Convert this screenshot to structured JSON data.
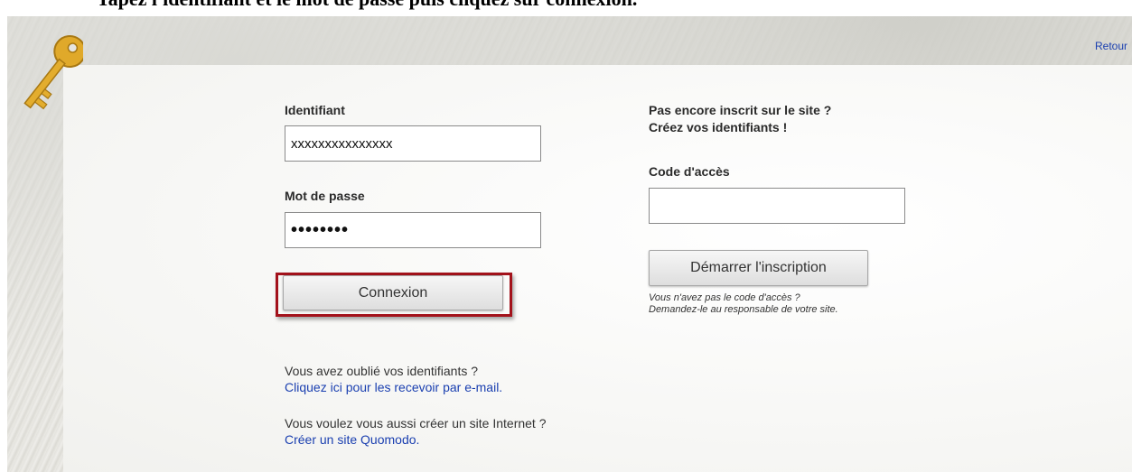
{
  "caption": "Tapez l'identifiant et le mot de passe puis cliquez sur connexion.",
  "back_link": "Retour",
  "login": {
    "identifiant_label": "Identifiant",
    "identifiant_value": "xxxxxxxxxxxxxxx",
    "password_label": "Mot de passe",
    "password_value": "••••••••",
    "connect_button": "Connexion"
  },
  "register": {
    "title_line1": "Pas encore inscrit sur le site ?",
    "title_line2": "Créez vos identifiants !",
    "code_label": "Code d'accès",
    "code_value": "",
    "start_button": "Démarrer l'inscription",
    "help_line1": "Vous n'avez pas le code d'accès ?",
    "help_line2": "Demandez-le au responsable de votre site."
  },
  "forgot": {
    "text": "Vous avez oublié vos identifiants ?",
    "link": "Cliquez ici pour les recevoir par e-mail."
  },
  "create_site": {
    "text": "Vous voulez vous aussi créer un site Internet ?",
    "link": "Créer un site Quomodo."
  },
  "colors": {
    "highlight": "#a3121b",
    "link": "#1a3fb0",
    "key": "#e0a92a"
  },
  "icons": [
    "key-icon"
  ]
}
